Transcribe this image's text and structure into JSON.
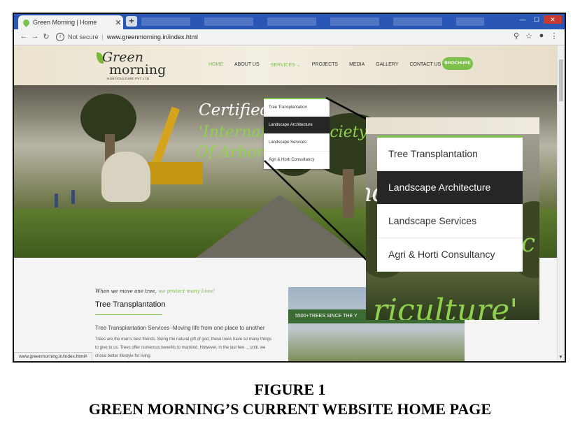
{
  "browser": {
    "tab_title": "Green Morning | Home",
    "tab_close": "✕",
    "new_tab": "+",
    "not_secure": "Not secure",
    "url": "www.greenmorning.in/index.html",
    "status_url": "www.greenmorning.in/index.html#"
  },
  "site": {
    "logo": {
      "line1": "Green",
      "line2": "morning",
      "line3": "HORTICULTURE PVT LTD"
    },
    "menu": {
      "home": "HOME",
      "about": "ABOUT US",
      "services": "SERVICES ⌄",
      "projects": "PROJECTS",
      "media": "MEDIA",
      "gallery": "GALLERY",
      "contact": "CONTACT US"
    },
    "brochure": "BROCHURE",
    "hero": {
      "line1": "Certified",
      "line2": "'International Society",
      "line3": "Of Arboriculture'"
    },
    "services_menu": [
      "Tree Transplantation",
      "Landscape Architecture",
      "Landscape Services",
      "Agri & Horti Consultancy"
    ],
    "selected_index": 1,
    "content": {
      "tagline_prefix": "When we move one tree,",
      "tagline_highlight": "we protect many lives!",
      "title": "Tree Transplantation",
      "lead": "Tree Transplantation Services -Moving life from one place to another",
      "body": "Trees are the man's best friends. Being the natural gift of god, these trees have so many things to give to us. Trees offer numerous benefits to mankind. However, in the last few ... until, we chose better lifestyle for living",
      "banner": "5500+TREES SINCE THE Y"
    }
  },
  "zoom": {
    "ghost_text_1": "nd",
    "ghost_text_2": "c",
    "big_text": "riculture'"
  },
  "caption": {
    "line1": "FIGURE 1",
    "line2": "GREEN MORNING’S CURRENT WEBSITE HOME PAGE"
  },
  "colors": {
    "accent_green": "#7cc04a",
    "selected_bg": "#262626",
    "tabbar_blue": "#2a57b5"
  }
}
